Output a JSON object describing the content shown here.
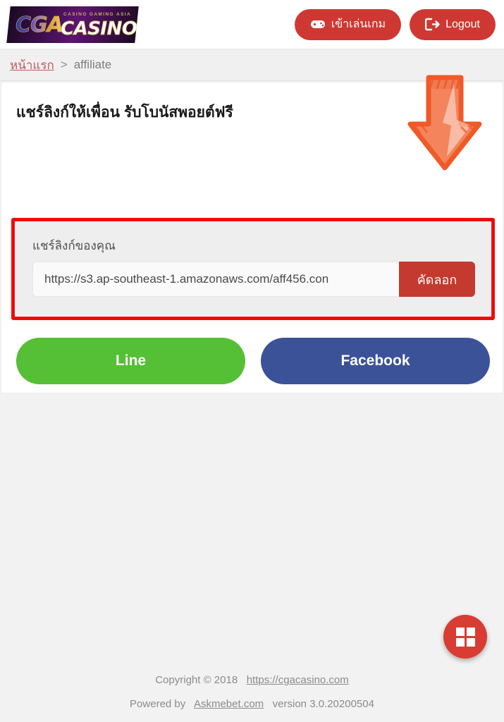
{
  "header": {
    "logo": {
      "brand_mark": "CGA",
      "brand_word": "CASINO",
      "tagline": "CASINO GAMING ASIA"
    },
    "play_button": {
      "label": "เข้าเล่นเกม",
      "icon": "gamepad-icon"
    },
    "logout_button": {
      "label": "Logout",
      "icon": "logout-icon"
    },
    "accent_color": "#cf3832"
  },
  "breadcrumb": {
    "home": "หน้าแรก",
    "separator": ">",
    "current": "affiliate"
  },
  "main": {
    "title": "แชร์ลิงก์ให้เพื่อน รับโบนัสพอยต์ฟรี",
    "share_panel": {
      "label": "แชร์ลิงก์ของคุณ",
      "link_value": "https://s3.ap-southeast-1.amazonaws.com/aff456.con",
      "link_placeholder": "https://",
      "copy_label": "คัดลอก",
      "copy_color": "#c43a2e"
    },
    "share_buttons": [
      {
        "label": "Line",
        "color": "#55bf35"
      },
      {
        "label": "Facebook",
        "color": "#3c5298"
      }
    ]
  },
  "annotations": {
    "highlight_color": "#f00b0b",
    "arrow_color": "#f4845c",
    "arrow_outline": "#ef5a28"
  },
  "fab": {
    "icon": "grid-icon",
    "color": "#d83c33"
  },
  "footer": {
    "copyright": "Copyright © 2018",
    "site_url": "https://cgacasino.com",
    "powered_by": "Powered by",
    "provider": "Askmebet.com",
    "version": "version 3.0.20200504"
  }
}
